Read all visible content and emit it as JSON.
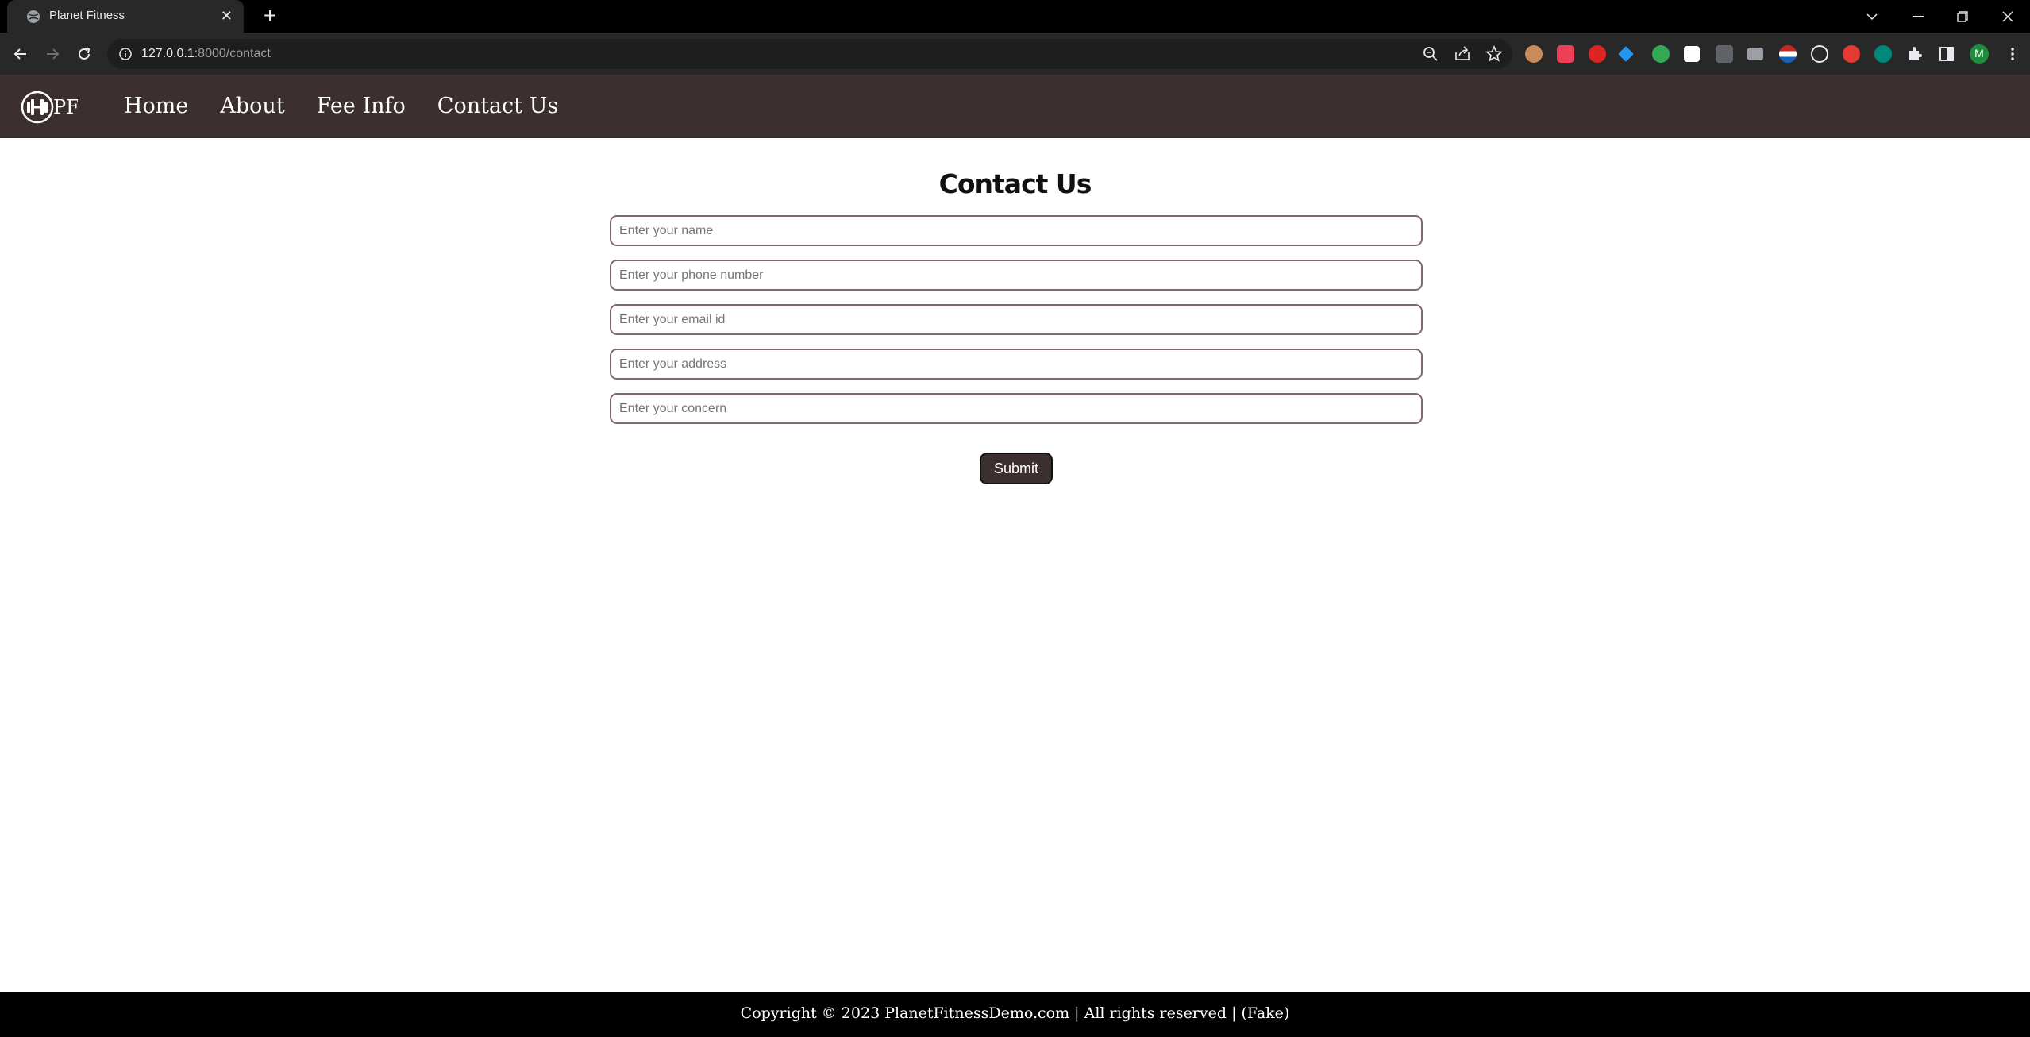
{
  "browser": {
    "tab_title": "Planet Fitness",
    "new_tab": "+",
    "url_host": "127.0.0.1",
    "url_path": ":8000/contact"
  },
  "site": {
    "logo_text": "PF",
    "nav": [
      {
        "label": "Home"
      },
      {
        "label": "About"
      },
      {
        "label": "Fee Info"
      },
      {
        "label": "Contact Us"
      }
    ]
  },
  "contact": {
    "title": "Contact Us",
    "fields": [
      {
        "placeholder": "Enter your name",
        "value": ""
      },
      {
        "placeholder": "Enter your phone number",
        "value": ""
      },
      {
        "placeholder": "Enter your email id",
        "value": ""
      },
      {
        "placeholder": "Enter your address",
        "value": ""
      },
      {
        "placeholder": "Enter your concern",
        "value": ""
      }
    ],
    "submit_label": "Submit"
  },
  "footer": {
    "text": "Copyright © 2023 PlanetFitnessDemo.com | All rights reserved | (Fake)"
  },
  "colors": {
    "nav_bg": "#3b2f2f",
    "footer_bg": "#000000",
    "button_bg": "#3b2f2f"
  },
  "profile_initial": "M"
}
